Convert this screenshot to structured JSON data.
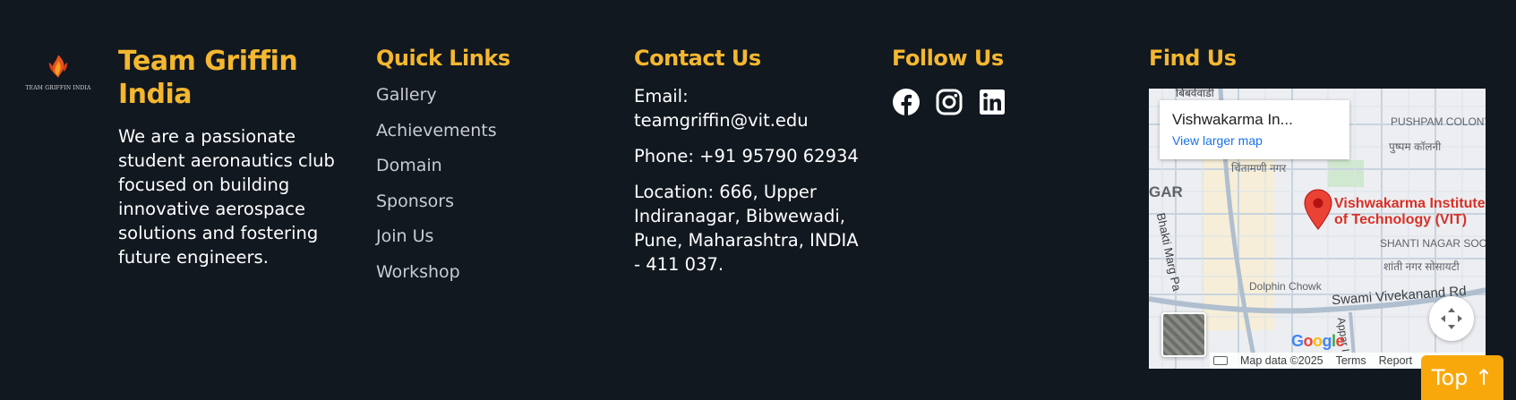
{
  "brand": {
    "logo_text": "TEAM GRIFFIN INDIA",
    "accent_color": "#f4b72f"
  },
  "about": {
    "title": "Team Griffin India",
    "description": "We are a passionate student aeronautics club focused on building innovative aerospace solutions and fostering future engineers."
  },
  "quick_links": {
    "title": "Quick Links",
    "items": [
      "Gallery",
      "Achievements",
      "Domain",
      "Sponsors",
      "Join Us",
      "Workshop"
    ]
  },
  "contact": {
    "title": "Contact Us",
    "email": "Email: teamgriffin@vit.edu",
    "phone": "Phone: +91 95790 62934",
    "location": "Location: 666, Upper Indiranagar, Bibwewadi, Pune, Maharashtra, INDIA - 411 037."
  },
  "follow": {
    "title": "Follow Us",
    "icons": [
      "facebook-icon",
      "instagram-icon",
      "linkedin-icon"
    ]
  },
  "find": {
    "title": "Find Us",
    "map": {
      "place_name": "Vishwakarma In...",
      "larger_map_link": "View larger map",
      "pin_label": "Vishwakarma Institute of Technology (VIT)",
      "area_labels": {
        "pushpam": "PUSHPAM COLONY",
        "pushpam_hi": "पुष्पम कॉलनी",
        "chintamani": "चिंतामणी नगर",
        "gar": "GAR",
        "shanti": "SHANTI NAGAR SOCIETY",
        "shanti_hi": "शांती नगर सोसायटी",
        "dolphin": "Dolphin Chowk",
        "swami": "Swami Vivekanand Rd",
        "bhakti": "Bhakti Marg Pa",
        "top_hi": "बिबवेवाडी",
        "appar": "Appar I"
      },
      "google_logo": "Google",
      "map_data": "Map data ©2025",
      "terms": "Terms",
      "report": "Report"
    }
  },
  "top_button": {
    "label": "Top ↑"
  }
}
